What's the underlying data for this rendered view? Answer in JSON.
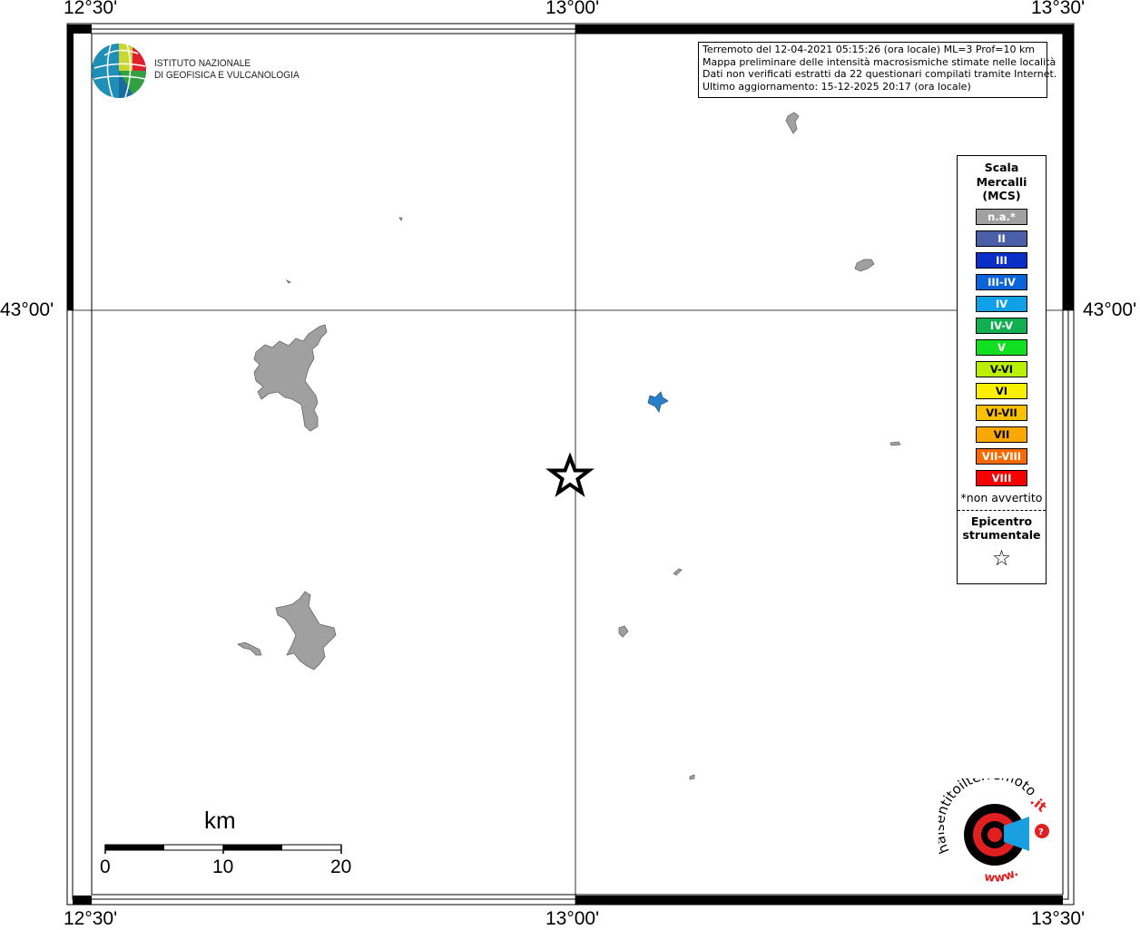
{
  "axis": {
    "lon_left": "12°30'",
    "lon_center": "13°00'",
    "lon_right": "13°30'",
    "lat_center": "43°00'"
  },
  "institute": {
    "line1": "ISTITUTO NAZIONALE",
    "line2": "DI GEOFISICA E VULCANOLOGIA"
  },
  "info": {
    "line1": "Terremoto del 12-04-2021 05:15:26 (ora locale) ML=3 Prof=10 km",
    "line2": "Mappa preliminare delle intensità macrosismiche stimate nelle località",
    "line3": "Dati non verificati estratti da 22 questionari compilati tramite Internet.",
    "line4": "Ultimo aggiornamento: 15-12-2025 20:17 (ora locale)"
  },
  "legend": {
    "title_line1": "Scala",
    "title_line2": "Mercalli",
    "title_line3": "(MCS)",
    "items": [
      {
        "label": "n.a.*",
        "color": "#a0a0a0"
      },
      {
        "label": "II",
        "color": "#4a5fa8"
      },
      {
        "label": "III",
        "color": "#0a2fc8"
      },
      {
        "label": "III-IV",
        "color": "#0a66d8"
      },
      {
        "label": "IV",
        "color": "#10a0e8"
      },
      {
        "label": "IV-V",
        "color": "#10b050"
      },
      {
        "label": "V",
        "color": "#10e020"
      },
      {
        "label": "V-VI",
        "color": "#b8f000"
      },
      {
        "label": "VI",
        "color": "#f8f000"
      },
      {
        "label": "VI-VII",
        "color": "#f8c000"
      },
      {
        "label": "VII",
        "color": "#f8a800"
      },
      {
        "label": "VII-VIII",
        "color": "#f86a00"
      },
      {
        "label": "VIII",
        "color": "#f80000"
      }
    ],
    "note": "*non avvertito",
    "epicentre_line1": "Epicentro",
    "epicentre_line2": "strumentale",
    "epicentre_symbol": "☆"
  },
  "scale_bar": {
    "unit": "km",
    "tick_0": "0",
    "tick_10": "10",
    "tick_20": "20"
  },
  "badge": {
    "text_main": "haisentitoilterremoto",
    "text_it": ".it",
    "text_www": "www."
  },
  "colors": {
    "land_gray": "#a0a0a0",
    "water_blue": "#2a80c8"
  }
}
